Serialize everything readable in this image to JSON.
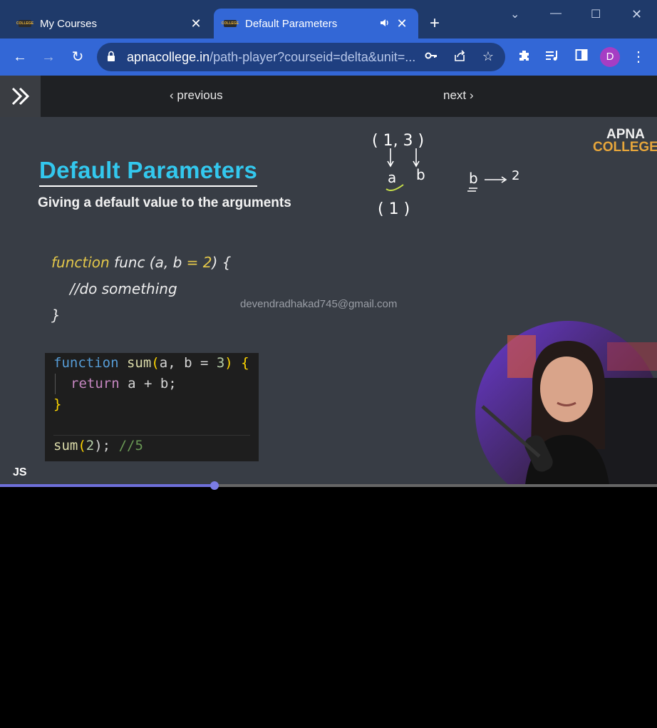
{
  "browser": {
    "tabs": [
      {
        "title": "My Courses",
        "active": false
      },
      {
        "title": "Default Parameters",
        "active": true,
        "audio": true
      }
    ],
    "favicon_text": "COLLEGE",
    "url_domain": "apnacollege.in",
    "url_path": "/path-player?courseid=delta&unit=...",
    "profile_initial": "D",
    "colors": {
      "tabbar": "#1f3a6a",
      "toolbar": "#3367d6",
      "avatar": "#a53ec4"
    }
  },
  "player_nav": {
    "previous_label": "previous",
    "next_label": "next"
  },
  "slide": {
    "title": "Default Parameters",
    "subtitle": "Giving a default value to the arguments",
    "code1": {
      "kw": "function",
      "sig_a": " func (a, b ",
      "eq": "=",
      "sp": " ",
      "two": "2",
      "sig_b": ") {",
      "body": "//do something",
      "close": "}"
    },
    "code2": {
      "fn_kw": "function",
      "fn_name": "sum",
      "paren_open": "(",
      "params": "a, b = ",
      "three": "3",
      "paren_close": ")",
      "brace_open": "{",
      "ret_kw": "return",
      "ret_expr": " a + b;",
      "brace_close": "}",
      "call_name": "sum",
      "call_arg": "2",
      "call_end": ");",
      "comment": "//5"
    },
    "handwriting": {
      "args": "( 1, 3 )",
      "a": "a",
      "b": "b",
      "one": "( 1 )",
      "b2": "b",
      "two": "2"
    },
    "watermark": "devendradhakad745@gmail.com",
    "label": "JS",
    "logo_line1": "APNA",
    "logo_line2": "COLLEGE"
  },
  "progress": {
    "fraction": 0.327
  }
}
